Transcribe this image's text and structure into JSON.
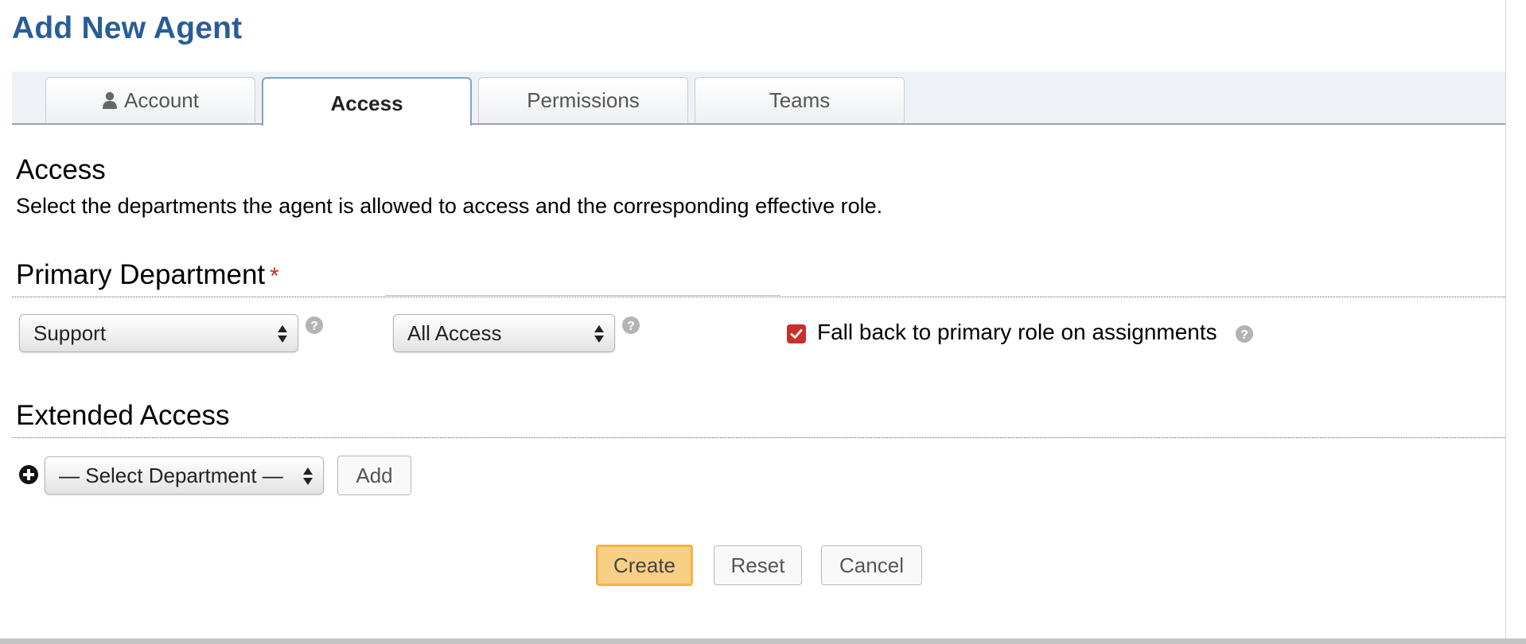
{
  "page": {
    "title": "Add New Agent"
  },
  "tabs": [
    {
      "label": "Account",
      "icon": "user-icon",
      "active": false
    },
    {
      "label": "Access",
      "active": true
    },
    {
      "label": "Permissions",
      "active": false
    },
    {
      "label": "Teams",
      "active": false
    }
  ],
  "access": {
    "heading": "Access",
    "description": "Select the departments the agent is allowed to access and the corresponding effective role."
  },
  "primary": {
    "heading": "Primary Department",
    "required_marker": "*",
    "department_select": "Support",
    "role_select": "All Access",
    "fallback_checked": true,
    "fallback_label": "Fall back to primary role on assignments"
  },
  "extended": {
    "heading": "Extended Access",
    "department_select": "— Select Department —",
    "add_label": "Add"
  },
  "actions": {
    "create_label": "Create",
    "reset_label": "Reset",
    "cancel_label": "Cancel"
  },
  "colors": {
    "title": "#2a5d96",
    "required": "#d02a2a",
    "checkbox": "#c8312b",
    "primary_button": "#f8cf85",
    "primary_button_border": "#f5b342"
  }
}
